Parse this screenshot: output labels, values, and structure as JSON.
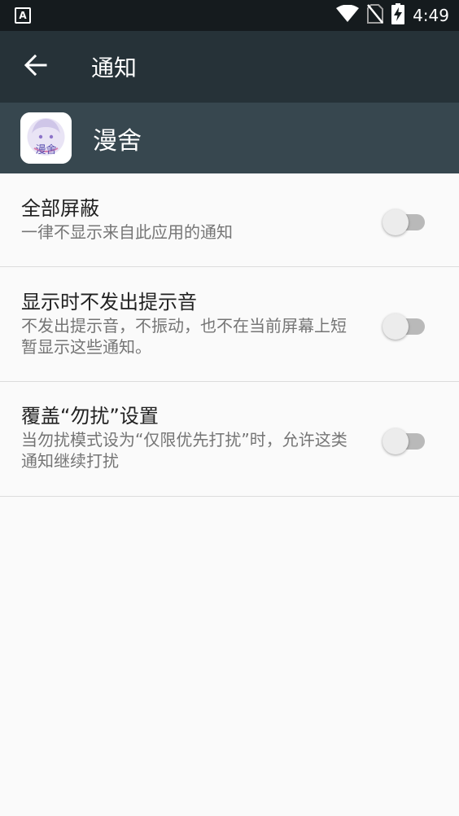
{
  "status_bar": {
    "time": "4:49",
    "notification_icon_letter": "A",
    "icons": [
      "wifi-icon",
      "no-sim-icon",
      "battery-charging-icon"
    ]
  },
  "toolbar": {
    "title": "通知",
    "back_icon": "arrow-back-icon"
  },
  "app_header": {
    "app_name": "漫舍",
    "app_icon_text": "漫舍"
  },
  "settings": [
    {
      "title": "全部屏蔽",
      "summary": "一律不显示来自此应用的通知",
      "enabled": false
    },
    {
      "title": "显示时不发出提示音",
      "summary": "不发出提示音，不振动，也不在当前屏幕上短暂显示这些通知。",
      "enabled": false
    },
    {
      "title": "覆盖“勿扰”设置",
      "summary": "当勿扰模式设为“仅限优先打扰”时，允许这类通知继续打扰",
      "enabled": false
    }
  ],
  "colors": {
    "status_bar": "#151b1e",
    "toolbar": "#263238",
    "app_header": "#37474f",
    "background": "#fafafa"
  }
}
